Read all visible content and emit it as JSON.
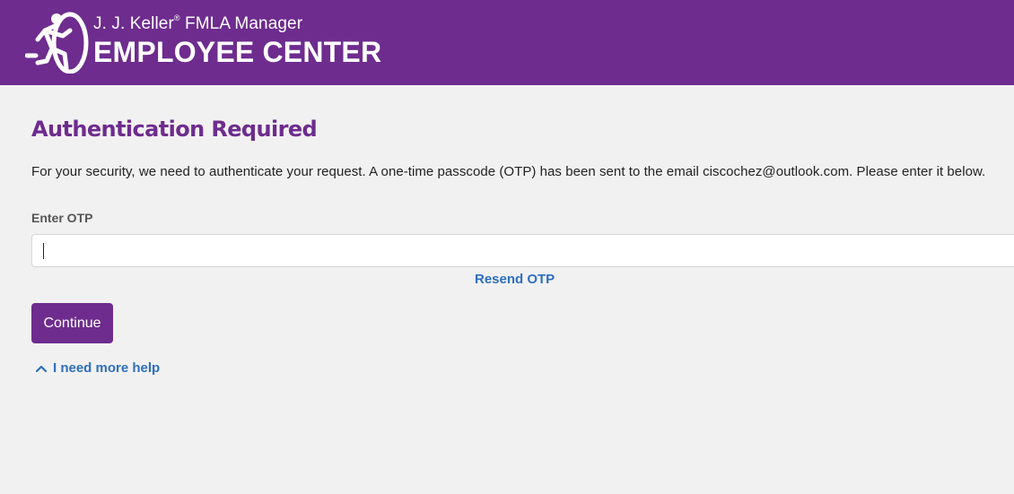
{
  "header": {
    "brand_line1_prefix": "J. J. Keller",
    "brand_registered_mark": "®",
    "brand_line1_suffix": "FMLA Manager",
    "brand_line2": "EMPLOYEE CENTER",
    "logo_icon": "running-figure-icon"
  },
  "main": {
    "title": "Authentication Required",
    "instructions": "For your security, we need to authenticate your request. A one-time passcode (OTP) has been sent to the email ciscochez@outlook.com. Please enter it below.",
    "otp_label": "Enter OTP",
    "otp_value": "",
    "resend_label": "Resend OTP",
    "continue_label": "Continue",
    "help_label": "I need more help",
    "help_icon": "chevron-up-icon"
  },
  "colors": {
    "brand_purple": "#6e2c8e",
    "link_blue": "#2d6fbf",
    "page_background": "#f2f1f2"
  }
}
